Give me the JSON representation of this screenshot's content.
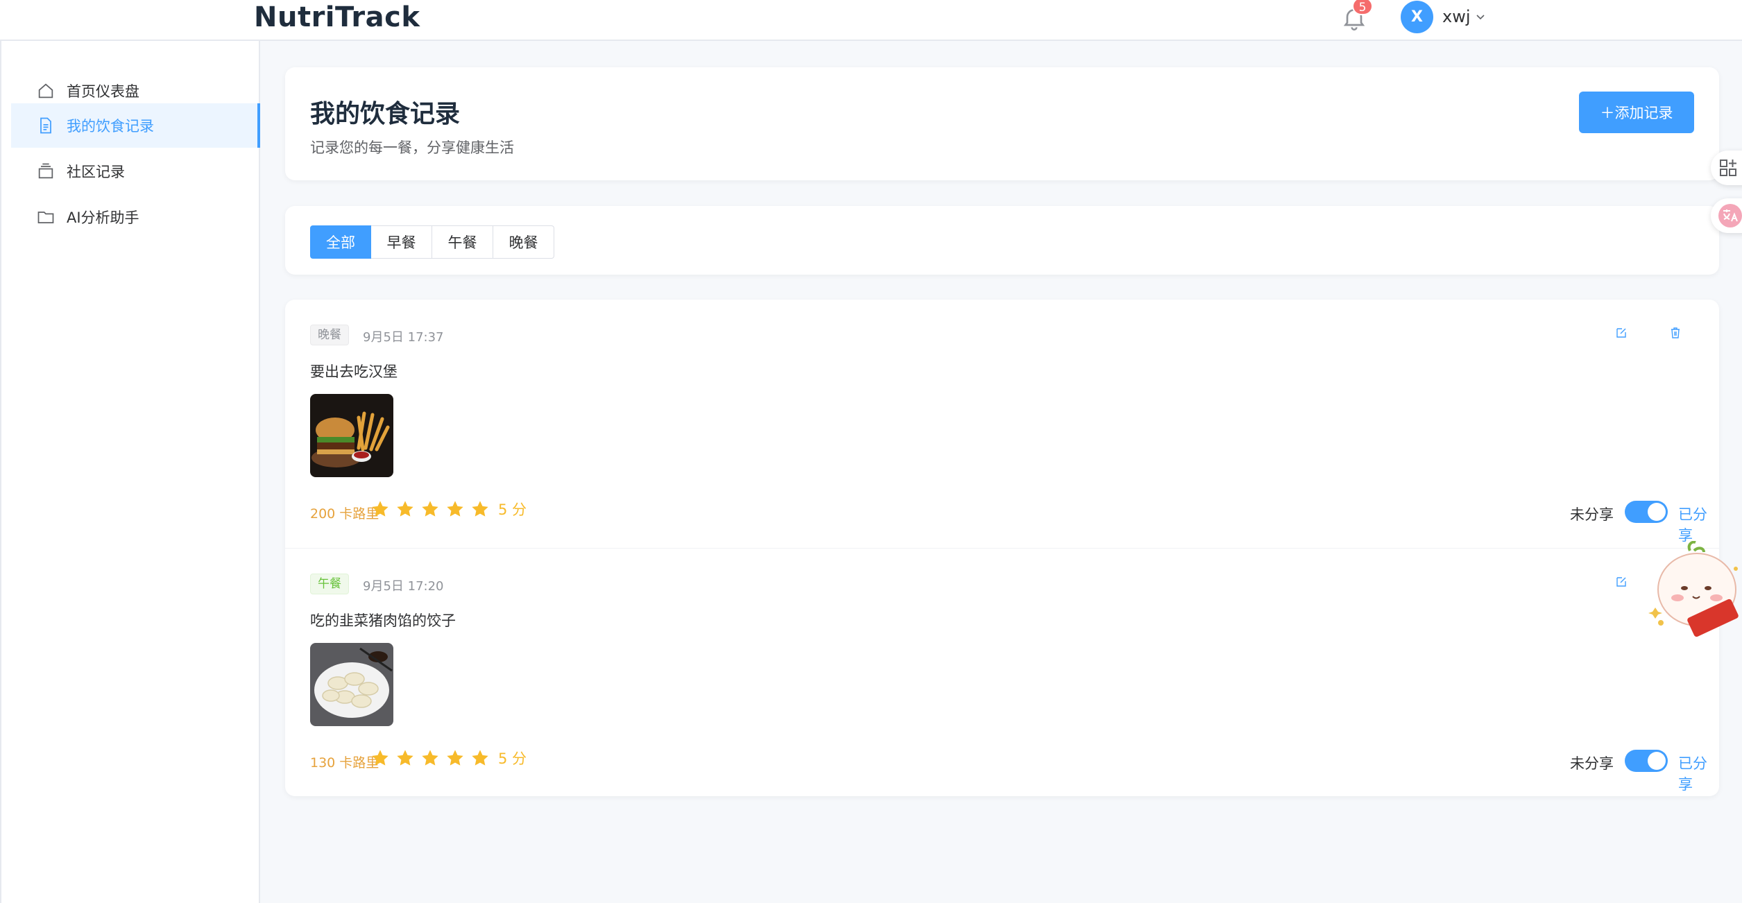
{
  "header": {
    "brand": "NutriTrack",
    "notifications_count": "5",
    "user": {
      "avatar_letter": "X",
      "name": "xwj"
    }
  },
  "sidebar": {
    "items": [
      {
        "label": "首页仪表盘",
        "icon": "home-icon",
        "active": false
      },
      {
        "label": "我的饮食记录",
        "icon": "document-icon",
        "active": true
      },
      {
        "label": "社区记录",
        "icon": "stack-icon",
        "active": false
      },
      {
        "label": "AI分析助手",
        "icon": "folder-icon",
        "active": false
      }
    ]
  },
  "page": {
    "title": "我的饮食记录",
    "subtitle": "记录您的每一餐，分享健康生活",
    "add_button": "＋添加记录"
  },
  "filters": {
    "tabs": [
      "全部",
      "早餐",
      "午餐",
      "晚餐"
    ],
    "selected": "全部"
  },
  "records": [
    {
      "meal": "晚餐",
      "time": "9月5日 17:37",
      "text": "要出去吃汉堡",
      "image": "burger-photo",
      "calories": "200 卡路里",
      "rating": 5,
      "score_label": "5 分",
      "share_off_label": "未分享",
      "share_on_label": "已分享",
      "shared": true,
      "has_delete": true
    },
    {
      "meal": "午餐",
      "time": "9月5日 17:20",
      "text": "吃的韭菜猪肉馅的饺子",
      "image": "dumplings-photo",
      "calories": "130 卡路里",
      "rating": 5,
      "score_label": "5 分",
      "share_off_label": "未分享",
      "share_on_label": "已分享",
      "shared": true,
      "has_delete": false
    }
  ],
  "colors": {
    "primary": "#409eff",
    "star": "#f7ba2a",
    "calories": "#e6a23c",
    "badge": "#f56c6c"
  }
}
